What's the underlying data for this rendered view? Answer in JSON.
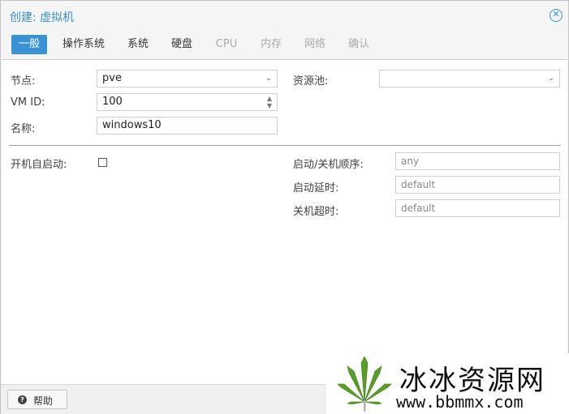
{
  "window": {
    "title": "创建: 虚拟机"
  },
  "tabs": [
    {
      "label": "一般",
      "state": "active"
    },
    {
      "label": "操作系统",
      "state": "enabled"
    },
    {
      "label": "系统",
      "state": "enabled"
    },
    {
      "label": "硬盘",
      "state": "enabled"
    },
    {
      "label": "CPU",
      "state": "disabled"
    },
    {
      "label": "内存",
      "state": "disabled"
    },
    {
      "label": "网络",
      "state": "disabled"
    },
    {
      "label": "确认",
      "state": "disabled"
    }
  ],
  "form": {
    "node_label": "节点:",
    "node_value": "pve",
    "vmid_label": "VM ID:",
    "vmid_value": "100",
    "name_label": "名称:",
    "name_value": "windows10",
    "pool_label": "资源池:",
    "pool_value": "",
    "autostart_label": "开机自启动:",
    "autostart_checked": false,
    "order_label": "启动/关机顺序:",
    "order_placeholder": "any",
    "delay_label": "启动延时:",
    "delay_placeholder": "default",
    "shutdown_label": "关机超时:",
    "shutdown_placeholder": "default"
  },
  "footer": {
    "help_label": "帮助"
  },
  "watermark": {
    "text_cn": "冰冰资源网",
    "url": "www.bbmmx.com"
  },
  "colors": {
    "accent": "#3892d4",
    "panel_bg": "#ffffff",
    "window_bg": "#f5f5f5"
  },
  "icons": {
    "close": "close-circle-icon",
    "help": "question-circle-icon",
    "dropdown": "chevron-down-icon",
    "spinner": "spinner-arrows-icon"
  }
}
